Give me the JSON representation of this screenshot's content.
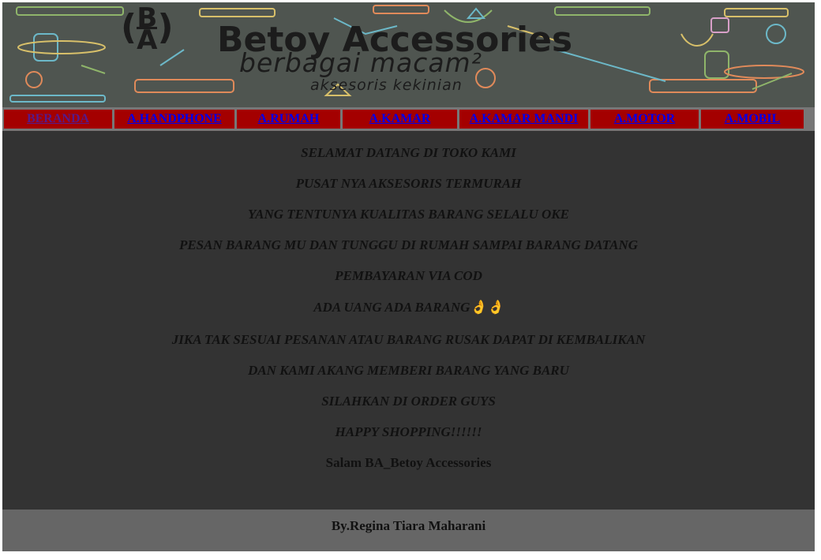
{
  "banner": {
    "logo_mark": "(B/A)",
    "title": "Betoy Accessories",
    "subtitle": "berbagai macam²",
    "tagline": "aksesoris kekinian"
  },
  "nav": {
    "items": [
      {
        "label": "BERANDA"
      },
      {
        "label": "A.HANDPHONE"
      },
      {
        "label": "A.RUMAH"
      },
      {
        "label": "A.KAMAR"
      },
      {
        "label": "A.KAMAR MANDI"
      },
      {
        "label": "A.MOTOR"
      },
      {
        "label": "A.MOBIL"
      }
    ]
  },
  "content": {
    "lines": [
      "SELAMAT DATANG DI TOKO KAMI",
      "PUSAT NYA AKSESORIS TERMURAH",
      "YANG TENTUNYA KUALITAS BARANG SELALU OKE",
      "PESAN BARANG MU DAN TUNGGU DI RUMAH SAMPAI BARANG DATANG",
      "PEMBAYARAN VIA COD",
      "ADA UANG ADA BARANG👌👌",
      "JIKA TAK SESUAI PESANAN ATAU BARANG RUSAK DAPAT DI KEMBALIKAN",
      "DAN KAMI AKANG MEMBERI BARANG YANG BARU",
      "SILAHKAN DI ORDER GUYS",
      "HAPPY SHOPPING!!!!!!"
    ],
    "closing": "Salam BA_Betoy Accessories"
  },
  "footer": {
    "credit": "By.Regina Tiara Maharani"
  },
  "colors": {
    "banner_bg": "#4f5550",
    "nav_bg": "#777777",
    "nav_item_bg": "#a40000",
    "link": "#0000ee",
    "visited_link": "#551a8b",
    "content_bg": "#333333",
    "footer_bg": "#666666",
    "text": "#111111"
  }
}
